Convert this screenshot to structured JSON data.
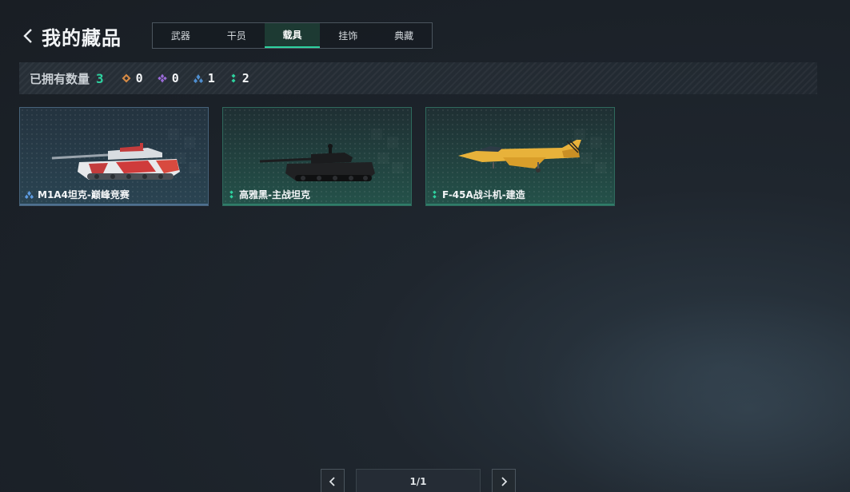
{
  "header": {
    "title": "我的藏品"
  },
  "tabs": [
    {
      "label": "武器"
    },
    {
      "label": "干员"
    },
    {
      "label": "载具",
      "active": true
    },
    {
      "label": "挂饰"
    },
    {
      "label": "典藏"
    }
  ],
  "stats": {
    "label": "已拥有数量",
    "total": "3",
    "rarities": [
      {
        "icon": "orange-diamond-icon",
        "color": "#d58a45",
        "count": "0"
      },
      {
        "icon": "purple-diamond-icon",
        "color": "#9a6bd8",
        "count": "0"
      },
      {
        "icon": "blue-diamond-icon",
        "color": "#4f8fd0",
        "count": "1"
      },
      {
        "icon": "green-diamond-icon",
        "color": "#2ed3a0",
        "count": "2"
      }
    ]
  },
  "items": [
    {
      "name": "M1A4坦克-巅峰竞赛",
      "rarity_icon": "blue-diamond-icon",
      "rarity_color": "#5d9be0",
      "theme": "blue"
    },
    {
      "name": "高雅黑-主战坦克",
      "rarity_icon": "green-diamond-icon",
      "rarity_color": "#2ed3a0",
      "theme": "green"
    },
    {
      "name": "F-45A战斗机-建造",
      "rarity_icon": "green-diamond-icon",
      "rarity_color": "#2ed3a0",
      "theme": "green"
    }
  ],
  "pagination": {
    "label": "1/1"
  },
  "colors": {
    "accent": "#2ed3a0",
    "background": "#1c232a"
  }
}
